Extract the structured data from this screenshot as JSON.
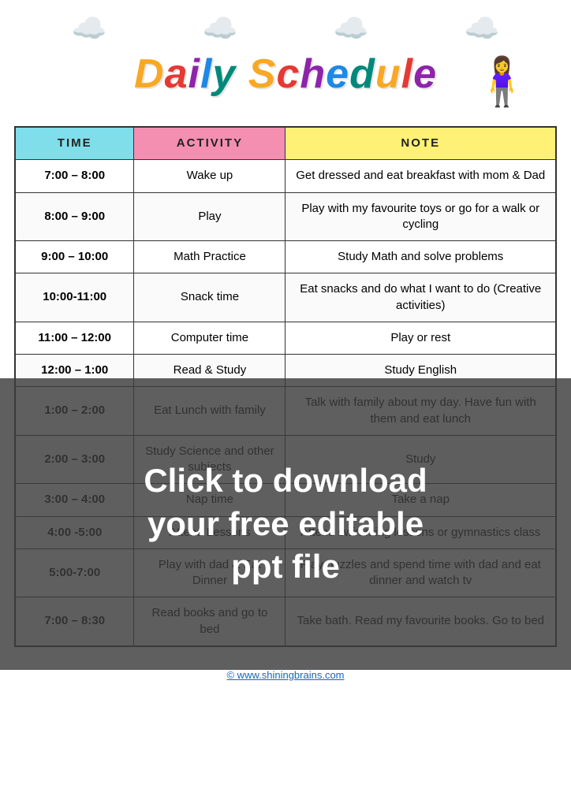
{
  "header": {
    "title": "Daily Schedule",
    "title_chars": [
      "D",
      "a",
      "i",
      "l",
      "y",
      " ",
      "S",
      "c",
      "h",
      "e",
      "d",
      "u",
      "l",
      "e"
    ]
  },
  "table": {
    "headers": [
      "TIME",
      "ACTIVITY",
      "NOTE"
    ],
    "rows": [
      {
        "time": "7:00 – 8:00",
        "activity": "Wake up",
        "note": "Get dressed and eat breakfast with mom & Dad"
      },
      {
        "time": "8:00 – 9:00",
        "activity": "Play",
        "note": "Play with my favourite toys or go for a walk or cycling"
      },
      {
        "time": "9:00 – 10:00",
        "activity": "Math Practice",
        "note": "Study Math and solve problems"
      },
      {
        "time": "10:00-11:00",
        "activity": "Snack time",
        "note": "Eat snacks and do what I want to do (Creative activities)"
      },
      {
        "time": "11:00 – 12:00",
        "activity": "Computer time",
        "note": "Play or rest"
      },
      {
        "time": "12:00 – 1:00",
        "activity": "Read & Study",
        "note": "Study English"
      },
      {
        "time": "1:00 – 2:00",
        "activity": "Eat Lunch with family",
        "note": "Talk with family about my day. Have fun with them and eat lunch"
      },
      {
        "time": "2:00 – 3:00",
        "activity": "Study Science and other subjects",
        "note": "Study"
      },
      {
        "time": "3:00 – 4:00",
        "activity": "Nap time",
        "note": "Take a nap"
      },
      {
        "time": "4:00 -5:00",
        "activity": "Attend Lessons",
        "note": "Attend swimming lessons or gymnastics class"
      },
      {
        "time": "5:00-7:00",
        "activity": "Play with dad & Eat Dinner",
        "note": "Play puzzles and spend time with dad and eat dinner and watch tv"
      },
      {
        "time": "7:00 – 8:30",
        "activity": "Read books and go to bed",
        "note": "Take bath. Read my favourite books. Go to bed"
      }
    ]
  },
  "overlay": {
    "text": "Click to download\nyour free editable\nppt file"
  },
  "footer": {
    "url": "© www.shiningbrains.com"
  }
}
